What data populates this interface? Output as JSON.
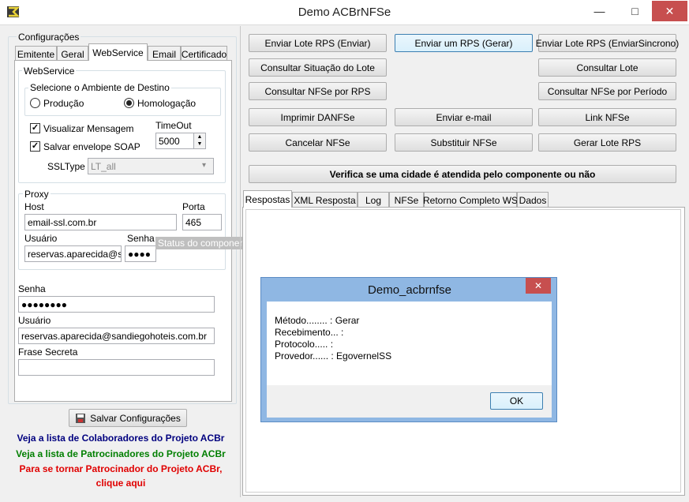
{
  "window": {
    "title": "Demo ACBrNFSe",
    "minimize": "—",
    "maximize": "□",
    "close": "✕"
  },
  "config": {
    "group_title": "Configurações",
    "tabs": [
      "Emitente",
      "Geral",
      "WebService",
      "Email",
      "Certificado"
    ],
    "selected_tab": "WebService",
    "webservice": {
      "group_title": "WebService",
      "ambiente_title": "Selecione o Ambiente de Destino",
      "producao": "Produção",
      "homologacao": "Homologação",
      "selected": "Homologação",
      "visualizar": "Visualizar Mensagem",
      "salvar_envelope": "Salvar envelope SOAP",
      "timeout_label": "TimeOut",
      "timeout_value": "5000",
      "ssltype_label": "SSLType",
      "ssltype_value": "LT_all"
    },
    "proxy": {
      "group_title": "Proxy",
      "host_label": "Host",
      "host_value": "email-ssl.com.br",
      "porta_label": "Porta",
      "porta_value": "465",
      "usuario_label": "Usuário",
      "usuario_value": "reservas.aparecida@sar",
      "senha_label": "Senha",
      "senha_value": "●●●●"
    },
    "status_bar": "Status do componente ACBrNFSe",
    "senha_label": "Senha",
    "senha_value": "●●●●●●●●",
    "usuario_label": "Usuário",
    "usuario_value": "reservas.aparecida@sandiegohoteis.com.br",
    "frase_label": "Frase Secreta",
    "frase_value": "",
    "save_button": "Salvar Configurações"
  },
  "links": {
    "colaboradores": "Veja a lista de Colaboradores do Projeto ACBr",
    "patrocinadores": "Veja a lista de Patrocinadores do Projeto ACBr",
    "tornar_1": "Para se tornar Patrocinador do Projeto ACBr,",
    "tornar_2": "clique aqui",
    "colors": {
      "blue": "#00007f",
      "green": "#007f00",
      "red": "#e00000"
    }
  },
  "actions": {
    "enviar_lote": "Enviar Lote RPS (Enviar)",
    "enviar_um": "Enviar um RPS (Gerar)",
    "enviar_lote_sinc": "Enviar Lote RPS (EnviarSincrono)",
    "consultar_situacao": "Consultar Situação do Lote",
    "consultar_lote": "Consultar Lote",
    "consultar_nfse_rps": "Consultar NFSe por RPS",
    "consultar_nfse_periodo": "Consultar NFSe por Período",
    "imprimir": "Imprimir DANFSe",
    "enviar_email": "Enviar e-mail",
    "link_nfse": "Link NFSe",
    "cancelar": "Cancelar NFSe",
    "substituir": "Substituir NFSe",
    "gerar_lote": "Gerar Lote RPS",
    "verifica_cidade": "Verifica se uma cidade é atendida pelo componente ou não"
  },
  "result_tabs": [
    "Respostas",
    "XML Resposta",
    "Log",
    "NFSe",
    "Retorno Completo WS",
    "Dados"
  ],
  "dialog": {
    "title": "Demo_acbrnfse",
    "close": "✕",
    "lines": [
      "Método........ : Gerar",
      "Recebimento... :",
      "Protocolo..... :",
      "Provedor...... : EgovernelSS"
    ],
    "ok": "OK"
  }
}
